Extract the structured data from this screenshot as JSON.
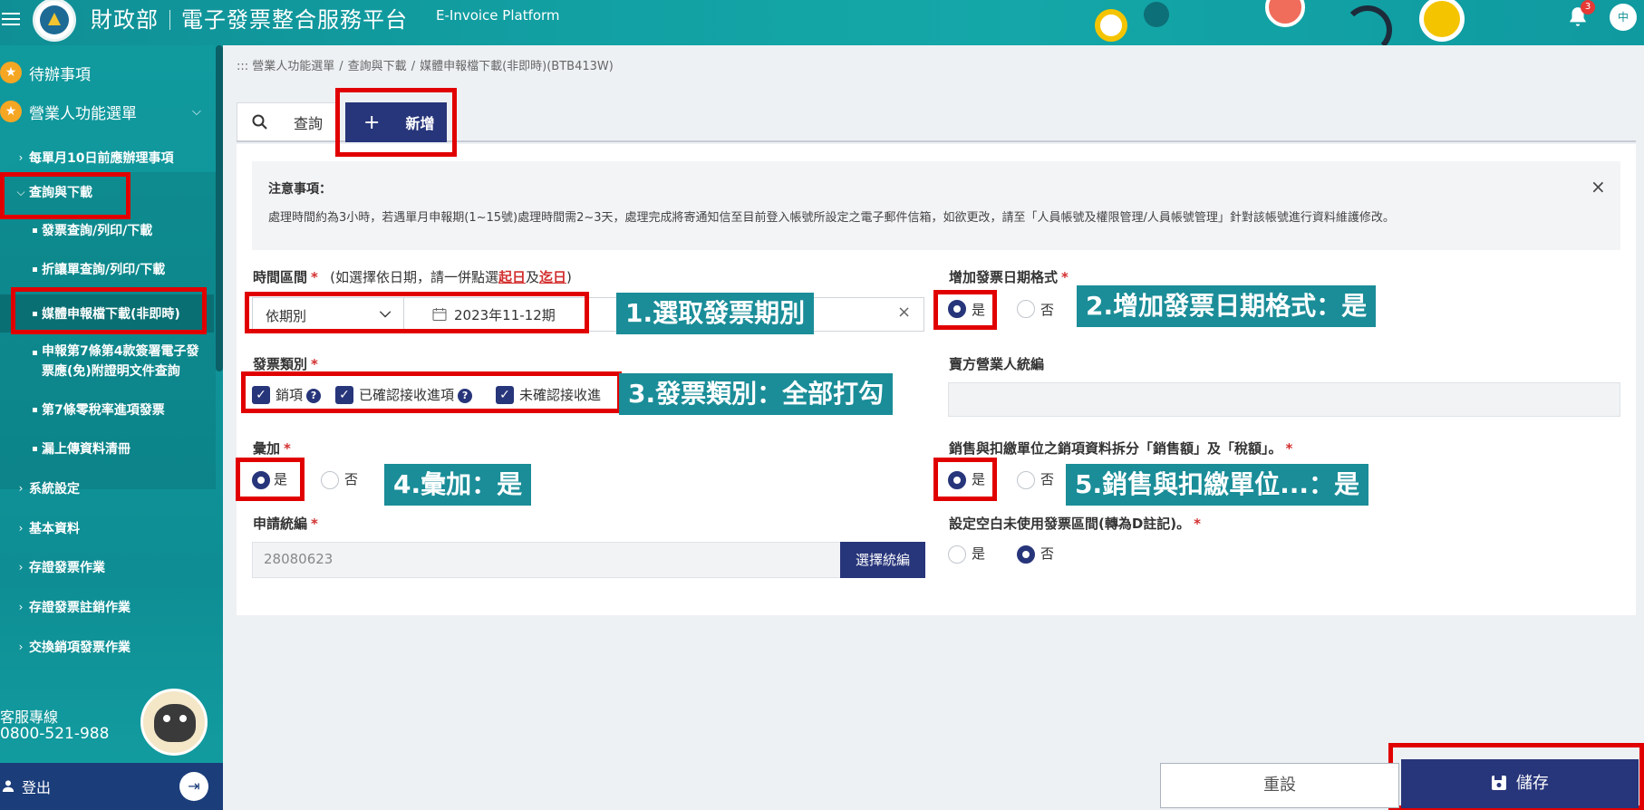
{
  "header": {
    "title_left": "財政部",
    "title_right": "電子發票整合服務平台",
    "title_en": "E-Invoice Platform",
    "notification_count": "3",
    "lang": "中"
  },
  "sidebar": {
    "pending": "待辦事項",
    "biz_menu": "營業人功能選單",
    "items": [
      "每單月10日前應辦理事項",
      "查詢與下載",
      "系統設定",
      "基本資料",
      "存證發票作業",
      "存證發票註銷作業",
      "交換銷項發票作業"
    ],
    "sub_items": [
      "發票查詢/列印/下載",
      "折讓單查詢/列印/下載",
      "媒體申報檔下載(非即時)",
      "申報第7條第4款簽署電子發",
      "票應(免)附證明文件查詢",
      "第7條零稅率進項發票",
      "漏上傳資料清冊"
    ],
    "service_label": "客服專線",
    "service_phone": "0800-521-988",
    "logout": "登出"
  },
  "breadcrumb": [
    ":::  營業人功能選單",
    "查詢與下載",
    "媒體申報檔下載(非即時)(BTB413W)"
  ],
  "tabs": {
    "search": "查詢",
    "add": "新增"
  },
  "notice": {
    "title": "注意事項：",
    "body": "處理時間約為3小時，若遇單月申報期(1~15號)處理時間需2~3天，處理完成將寄通知信至目前登入帳號所設定之電子郵件信箱，如欲更改，請至「人員帳號及權限管理/人員帳號管理」針對該帳號進行資料維護修改。"
  },
  "form": {
    "period_label": "時間區間",
    "period_hint_pre": "(如選擇依日期，請一併點選",
    "period_hint_start": "起日",
    "period_hint_mid": "及",
    "period_hint_end": "迄日",
    "period_hint_post": ")",
    "period_type": "依期別",
    "period_value": "2023年11-12期",
    "date_format_label": "增加發票日期格式",
    "invoice_type_label": "發票類別",
    "invoice_types": [
      "銷項",
      "已確認接收進項",
      "未確認接收進"
    ],
    "seller_tax_label": "賣方營業人統編",
    "aggregate_label": "彙加",
    "split_label": "銷售與扣繳單位之銷項資料拆分「銷售額」及「稅額」。",
    "tax_id_label": "申請統編",
    "tax_id_value": "28080623",
    "select_tax_btn": "選擇統編",
    "blank_label": "設定空白未使用發票區間(轉為D註記)。",
    "yes": "是",
    "no": "否",
    "required_mark": "*",
    "clear": "×"
  },
  "callouts": [
    "1.選取發票期別",
    "2.增加發票日期格式：是",
    "3.發票類別：全部打勾",
    "4.彙加：是",
    "5.銷售與扣繳單位...：是"
  ],
  "buttons": {
    "reset": "重設",
    "save": "儲存"
  },
  "colors": {
    "primary": "#27357a",
    "teal": "#109a9e",
    "annotation_red": "#e10000"
  }
}
